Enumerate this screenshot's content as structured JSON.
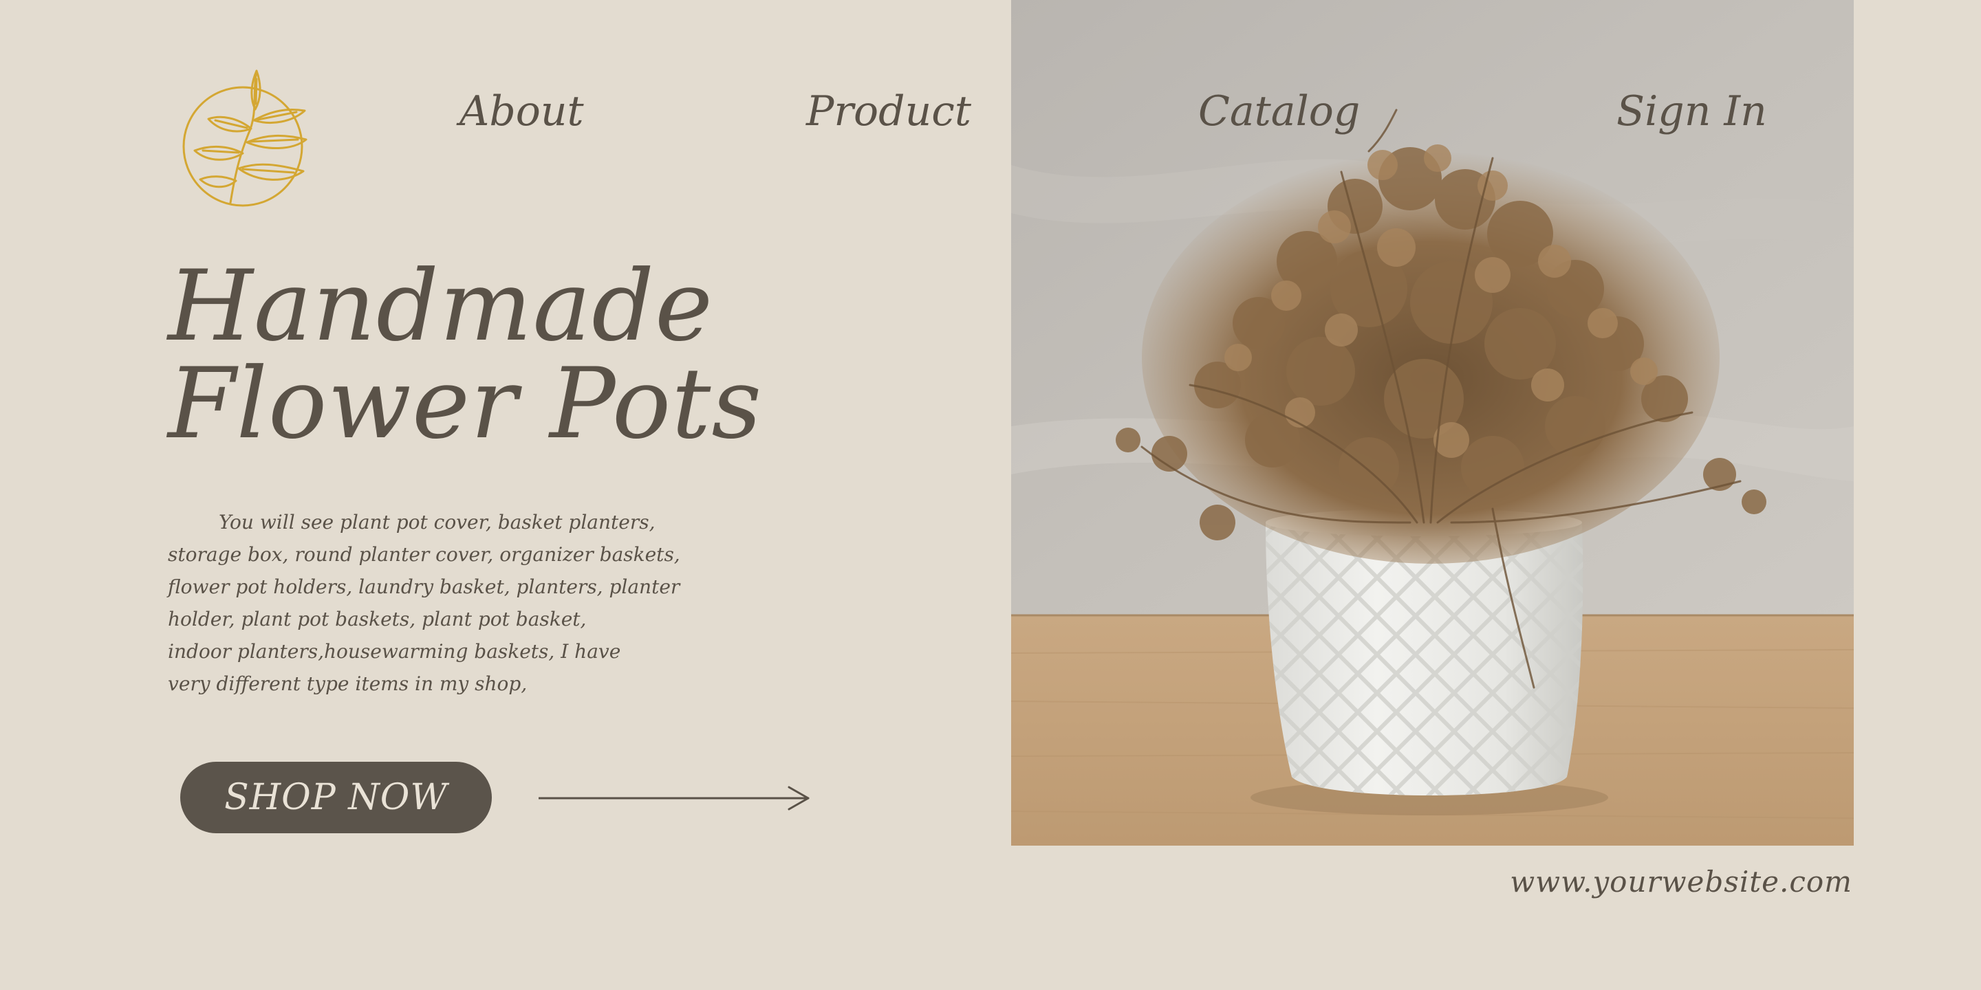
{
  "nav": {
    "items": [
      "About",
      "Product",
      "Catalog",
      "Sign In"
    ]
  },
  "hero": {
    "title_lines": [
      "Handmade",
      "Flower Pots"
    ],
    "description_lines": [
      "You will see plant pot cover, basket planters,",
      "storage box, round planter cover, organizer baskets,",
      "flower pot holders, laundry basket, planters, planter",
      "holder, plant pot baskets, plant pot basket,",
      "indoor planters,housewarming baskets, I have",
      "very different type items in my shop,"
    ],
    "cta_label": "SHOP NOW"
  },
  "footer": {
    "website": "www.yourwebsite.com"
  },
  "icons": {
    "logo": "leaf-branch-circle-logo",
    "arrow": "arrow-right-icon"
  },
  "colors": {
    "background": "#e3dcd0",
    "text": "#5a5248",
    "button": "#5b544b",
    "button_text": "#e9e2d6",
    "logo_gold": "#d4a733"
  }
}
